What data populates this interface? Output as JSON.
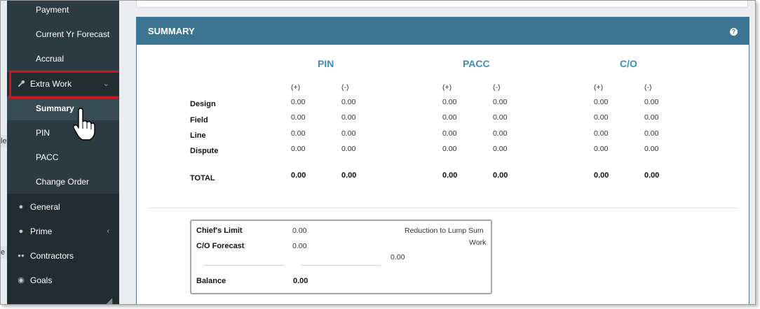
{
  "sidebar": {
    "submenu": [
      {
        "label": "Payment"
      },
      {
        "label": "Current Yr Forecast"
      },
      {
        "label": "Accrual"
      }
    ],
    "extra_work": {
      "label": "Extra Work",
      "icon": "wrench-icon",
      "chevron": "⌄"
    },
    "extra_work_sub": [
      {
        "label": "Summary",
        "active": true
      },
      {
        "label": "PIN"
      },
      {
        "label": "PACC"
      },
      {
        "label": "Change Order"
      }
    ],
    "items": [
      {
        "label": "General",
        "icon": "lightbulb-icon",
        "glyph": "●"
      },
      {
        "label": "Prime",
        "icon": "user-icon",
        "glyph": "●",
        "chevron": "‹"
      },
      {
        "label": "Contractors",
        "icon": "users-icon",
        "glyph": "●●"
      },
      {
        "label": "Goals",
        "icon": "compass-icon",
        "glyph": "◉"
      }
    ],
    "collapse_glyph": "◢",
    "edge_fragments": [
      "le",
      "e"
    ]
  },
  "panel": {
    "title": "SUMMARY",
    "help_glyph": "?",
    "columns": [
      "PIN",
      "PACC",
      "C/O"
    ],
    "sign_headers": [
      "(+)",
      "(-)"
    ],
    "rows": [
      {
        "label": "Design",
        "values": [
          "0.00",
          "0.00",
          "0.00",
          "0.00",
          "0.00",
          "0.00"
        ]
      },
      {
        "label": "Field",
        "values": [
          "0.00",
          "0.00",
          "0.00",
          "0.00",
          "0.00",
          "0.00"
        ]
      },
      {
        "label": "Line",
        "values": [
          "0.00",
          "0.00",
          "0.00",
          "0.00",
          "0.00",
          "0.00"
        ]
      },
      {
        "label": "Dispute",
        "values": [
          "0.00",
          "0.00",
          "0.00",
          "0.00",
          "0.00",
          "0.00"
        ]
      }
    ],
    "total": {
      "label": "TOTAL",
      "values": [
        "0.00",
        "0.00",
        "0.00",
        "0.00",
        "0.00",
        "0.00"
      ]
    }
  },
  "limits": {
    "chiefs_limit_label": "Chief's Limit",
    "chiefs_limit_value": "0.00",
    "co_forecast_label": "C/O Forecast",
    "co_forecast_value": "0.00",
    "reduction_label_1": "Reduction to Lump Sum",
    "reduction_label_2": "Work",
    "reduction_value": "0.00",
    "balance_label": "Balance",
    "balance_value": "0.00"
  }
}
